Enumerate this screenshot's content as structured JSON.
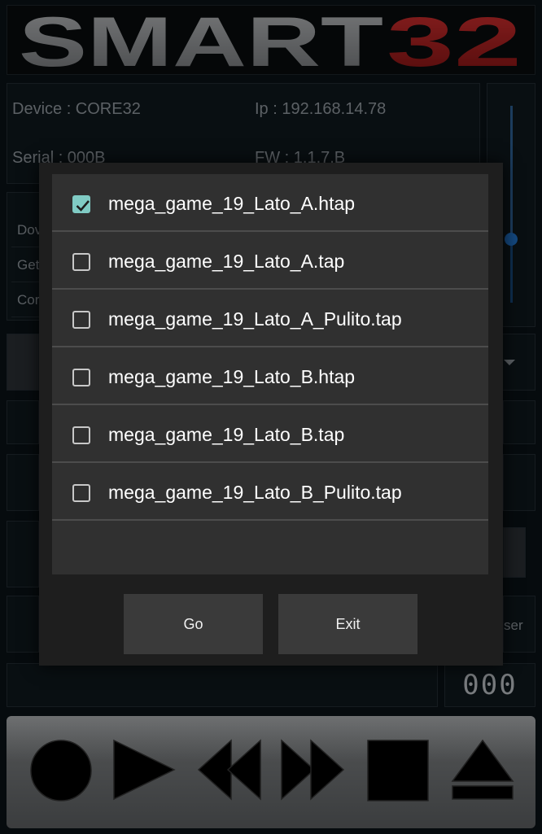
{
  "logo": {
    "text_left": "SMART",
    "text_right": "32"
  },
  "device": {
    "device_label": "Device : CORE32",
    "ip_label": "Ip : 192.168.14.78",
    "serial_label": "Serial : 000B",
    "fw_label": "FW : 1.1.7.B"
  },
  "side_menu": {
    "items": [
      "Dov",
      "Get",
      "Cor"
    ]
  },
  "background_button_fragment": "ser",
  "counter": "000",
  "transport": {
    "buttons": [
      "record",
      "play",
      "rewind",
      "fast-forward",
      "stop",
      "eject"
    ]
  },
  "dialog": {
    "files": [
      {
        "name": "mega_game_19_Lato_A.htap",
        "checked": true
      },
      {
        "name": "mega_game_19_Lato_A.tap",
        "checked": false
      },
      {
        "name": "mega_game_19_Lato_A_Pulito.tap",
        "checked": false
      },
      {
        "name": "mega_game_19_Lato_B.htap",
        "checked": false
      },
      {
        "name": "mega_game_19_Lato_B.tap",
        "checked": false
      },
      {
        "name": "mega_game_19_Lato_B_Pulito.tap",
        "checked": false
      }
    ],
    "go_label": "Go",
    "exit_label": "Exit"
  },
  "colors": {
    "logo_gray": "#8d9093",
    "logo_red": "#b21e1e",
    "checkbox_accent": "#80cbc4",
    "slider_blue": "#1f6fc4"
  }
}
